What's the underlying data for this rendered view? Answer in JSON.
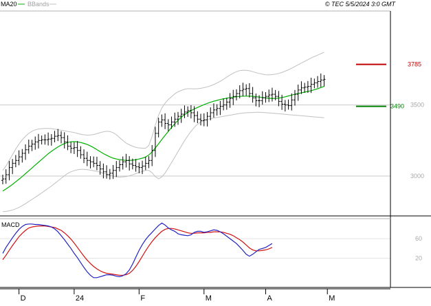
{
  "header": {
    "legend_ma": "MA20",
    "legend_bb": "BBands",
    "copyright": "© TEC 5/5/2024 3:0 GMT"
  },
  "colors": {
    "price": "#000000",
    "ma": "#00b000",
    "bbands": "#c0c0c0",
    "resistance": "#c00000",
    "support": "#008000",
    "macd": "#2020c0",
    "signal": "#d01010",
    "grid": "#c8c8c8"
  },
  "chart_data": [
    {
      "type": "line",
      "name": "price-panel",
      "ylim": [
        2720,
        4160
      ],
      "x_range": [
        0,
        108
      ],
      "y_ticks": [
        {
          "value": 3000,
          "label": "3000"
        },
        {
          "value": 3500,
          "label": "3500"
        }
      ],
      "x_ticks": [
        {
          "index": 5,
          "label": "D"
        },
        {
          "index": 22,
          "label": "24"
        },
        {
          "index": 42,
          "label": "F"
        },
        {
          "index": 62,
          "label": "M"
        },
        {
          "index": 81,
          "label": "A"
        },
        {
          "index": 100,
          "label": "M"
        }
      ],
      "grid": true,
      "levels": [
        {
          "name": "resistance",
          "value": 3785,
          "label": "3785"
        },
        {
          "name": "support",
          "value": 3490,
          "label": "3490"
        }
      ],
      "series": [
        {
          "name": "MA20",
          "kind": "line",
          "values": [
            2895,
            2910,
            2925,
            2942,
            2960,
            2978,
            2997,
            3017,
            3037,
            3057,
            3077,
            3097,
            3117,
            3137,
            3157,
            3174,
            3190,
            3205,
            3218,
            3228,
            3236,
            3241,
            3242,
            3240,
            3236,
            3230,
            3222,
            3212,
            3200,
            3186,
            3172,
            3158,
            3146,
            3135,
            3126,
            3120,
            3116,
            3113,
            3110,
            3110,
            3112,
            3115,
            3120,
            3126,
            3134,
            3148,
            3170,
            3198,
            3227,
            3257,
            3286,
            3314,
            3342,
            3368,
            3392,
            3414,
            3432,
            3447,
            3460,
            3472,
            3482,
            3492,
            3502,
            3511,
            3519,
            3526,
            3532,
            3538,
            3543,
            3547,
            3551,
            3555,
            3558,
            3560,
            3562,
            3562,
            3562,
            3561,
            3558,
            3555,
            3552,
            3549,
            3547,
            3546,
            3546,
            3548,
            3552,
            3557,
            3563,
            3569,
            3575,
            3580,
            3585,
            3590,
            3595,
            3600,
            3607,
            3614,
            3622,
            3630
          ]
        },
        {
          "name": "BBands",
          "kind": "band-upper",
          "values": [
            3040,
            3070,
            3110,
            3150,
            3190,
            3225,
            3255,
            3280,
            3300,
            3315,
            3325,
            3330,
            3333,
            3335,
            3335,
            3333,
            3330,
            3326,
            3322,
            3318,
            3314,
            3310,
            3306,
            3300,
            3294,
            3290,
            3288,
            3289,
            3292,
            3298,
            3305,
            3311,
            3315,
            3313,
            3305,
            3290,
            3270,
            3250,
            3232,
            3220,
            3210,
            3202,
            3198,
            3196,
            3196,
            3215,
            3278,
            3358,
            3428,
            3478,
            3512,
            3538,
            3558,
            3578,
            3592,
            3602,
            3610,
            3614,
            3614,
            3613,
            3614,
            3617,
            3621,
            3627,
            3634,
            3643,
            3654,
            3666,
            3680,
            3695,
            3710,
            3723,
            3734,
            3741,
            3744,
            3743,
            3740,
            3734,
            3727,
            3721,
            3716,
            3712,
            3711,
            3713,
            3716,
            3721,
            3728,
            3737,
            3747,
            3758,
            3770,
            3782,
            3794,
            3806,
            3818,
            3830,
            3840,
            3850,
            3860,
            3870
          ]
        },
        {
          "name": "BBands",
          "kind": "band-lower",
          "values": [
            2750,
            2752,
            2756,
            2762,
            2770,
            2780,
            2792,
            2806,
            2821,
            2836,
            2851,
            2866,
            2882,
            2898,
            2914,
            2930,
            2948,
            2966,
            2984,
            3002,
            3018,
            3030,
            3038,
            3044,
            3047,
            3047,
            3045,
            3042,
            3038,
            3033,
            3027,
            3020,
            3013,
            3006,
            3000,
            2995,
            2993,
            2994,
            2997,
            3002,
            3009,
            3017,
            3025,
            3033,
            3040,
            3040,
            3024,
            2996,
            2981,
            2994,
            3021,
            3057,
            3095,
            3133,
            3172,
            3210,
            3248,
            3283,
            3315,
            3342,
            3364,
            3380,
            3390,
            3398,
            3404,
            3408,
            3412,
            3416,
            3420,
            3424,
            3428,
            3432,
            3436,
            3440,
            3443,
            3445,
            3446,
            3447,
            3448,
            3448,
            3447,
            3446,
            3444,
            3442,
            3440,
            3438,
            3436,
            3434,
            3432,
            3430,
            3428,
            3426,
            3424,
            3422,
            3420,
            3418,
            3416,
            3414,
            3412,
            3410
          ]
        },
        {
          "name": "price",
          "kind": "bars",
          "values": [
            2980,
            3010,
            3060,
            3090,
            3110,
            3135,
            3160,
            3185,
            3210,
            3225,
            3240,
            3250,
            3255,
            3255,
            3260,
            3265,
            3280,
            3285,
            3270,
            3240,
            3210,
            3195,
            3200,
            3180,
            3150,
            3125,
            3110,
            3100,
            3090,
            3075,
            3050,
            3030,
            3010,
            3020,
            3040,
            3060,
            3080,
            3100,
            3110,
            3085,
            3075,
            3065,
            3060,
            3070,
            3090,
            3110,
            3180,
            3300,
            3380,
            3395,
            3370,
            3360,
            3380,
            3400,
            3420,
            3435,
            3450,
            3460,
            3445,
            3425,
            3400,
            3390,
            3395,
            3420,
            3445,
            3465,
            3475,
            3490,
            3500,
            3520,
            3545,
            3560,
            3580,
            3600,
            3610,
            3615,
            3580,
            3550,
            3530,
            3530,
            3550,
            3560,
            3570,
            3575,
            3560,
            3525,
            3505,
            3500,
            3495,
            3535,
            3575,
            3605,
            3620,
            3625,
            3630,
            3645,
            3655,
            3665,
            3675,
            3680
          ]
        }
      ]
    },
    {
      "type": "line",
      "name": "macd-panel",
      "title": "MACD",
      "ylim": [
        -40,
        101
      ],
      "y_ticks": [
        {
          "value": 20,
          "label": "20"
        },
        {
          "value": 60,
          "label": "60"
        }
      ],
      "grid": true,
      "series": [
        {
          "name": "MACD",
          "values": [
            30,
            42,
            52,
            62,
            71,
            79,
            85,
            89,
            90,
            90,
            89,
            89,
            88,
            87,
            86,
            84,
            80,
            74,
            66,
            58,
            49,
            40,
            30,
            21,
            11,
            1,
            -8,
            -15,
            -20,
            -20,
            -18,
            -16,
            -14,
            -14,
            -15,
            -17,
            -18,
            -16,
            -12,
            -4,
            8,
            22,
            36,
            48,
            58,
            66,
            73,
            80,
            87,
            92,
            88,
            82,
            78,
            75,
            70,
            68,
            67,
            66,
            68,
            73,
            75,
            75,
            73,
            74,
            76,
            78,
            77,
            74,
            70,
            65,
            60,
            55,
            50,
            43,
            36,
            28,
            24,
            28,
            33,
            38,
            40,
            42,
            46,
            50
          ]
        },
        {
          "name": "Signal",
          "values": [
            17,
            26,
            36,
            46,
            55,
            64,
            71,
            77,
            82,
            84,
            85,
            86,
            86,
            86,
            85,
            84,
            83,
            80,
            77,
            72,
            66,
            59,
            51,
            42,
            33,
            24,
            16,
            9,
            3,
            -2,
            -6,
            -9,
            -11,
            -12,
            -13,
            -14,
            -15,
            -15,
            -14,
            -11,
            -5,
            3,
            13,
            24,
            35,
            45,
            54,
            62,
            69,
            75,
            79,
            81,
            81,
            80,
            78,
            76,
            74,
            72,
            71,
            71,
            72,
            72,
            72,
            73,
            73,
            74,
            74,
            74,
            73,
            71,
            69,
            66,
            62,
            58,
            53,
            47,
            41,
            37,
            35,
            35,
            36,
            37,
            39,
            42
          ]
        }
      ]
    }
  ]
}
